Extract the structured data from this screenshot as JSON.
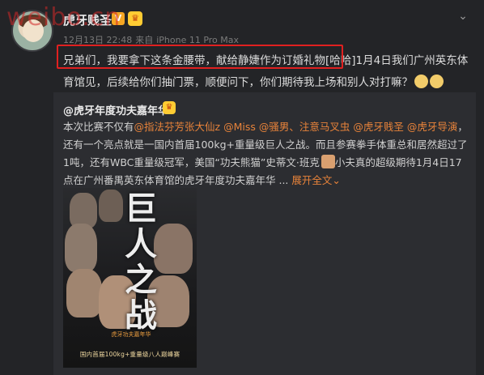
{
  "watermark": "weibo.cn",
  "post": {
    "username": "虎牙贱圣",
    "vip_badge": "V",
    "timestamp": "12月13日 22:48",
    "source_prefix": "来自",
    "source": "iPhone 11 Pro Max",
    "text_highlighted": "兄弟们，我要拿下这条金腰带，献给静婕作为订婚礼物",
    "text_rest": "[哈哈]1月4日我们广州英东体育馆见，后续给你们抽门票，顺便问下，你们期待我上场和别人对打嘛？",
    "menu_icon": "chevron-down-icon"
  },
  "repost": {
    "author": "@虎牙年度功夫嘉年华",
    "text_intro": "本次比赛不仅有",
    "mentions": [
      "@指法芬芳张大仙z",
      "@Miss",
      "@骚男",
      "、注意马叉虫",
      "@虎牙贱圣",
      "@虎牙导演"
    ],
    "text_body": "，还有一个亮点就是一国内首届100kg+重量级巨人之战。而且参赛拳手体重总和居然超过了1吨，还有WBC重量级冠军，美国“功夫熊猫”史蒂文·班克",
    "text_tail": "小夫真的超级期待1月4日17点在广州番禺英东体育馆的虎牙年度功夫嘉年华 ...",
    "expand_label": "展开全文",
    "expand_icon": "chevron-down-icon"
  },
  "poster": {
    "title_chars": [
      "巨",
      "人",
      "之",
      "战"
    ],
    "logo_text": "虎牙功夫嘉年华",
    "banner_text": "国内首届100kg+重量级八人巅峰赛"
  }
}
